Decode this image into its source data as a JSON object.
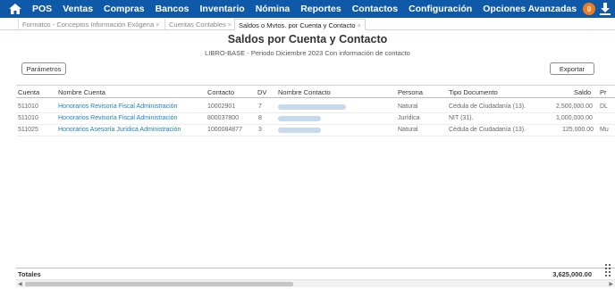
{
  "nav": {
    "items": [
      "POS",
      "Ventas",
      "Compras",
      "Bancos",
      "Inventario",
      "Nómina",
      "Reportes",
      "Contactos",
      "Configuración",
      "Opciones Avanzadas"
    ],
    "notification_count": "0"
  },
  "tabs": [
    {
      "label": "Formatos - Conceptos Información Exógena",
      "close": "×"
    },
    {
      "label": "Cuentas Contables",
      "close": "×"
    },
    {
      "label": "Saldos o Mvtos. por Cuenta y Contacto",
      "close": "×"
    }
  ],
  "report": {
    "title": "Saldos por Cuenta y Contacto",
    "subtitle": "LIBRO-BASE - Periodo Diciembre 2023 Con información de contacto"
  },
  "buttons": {
    "params": "Parámetros",
    "export": "Exportar"
  },
  "table": {
    "headers": [
      "Cuenta",
      "Nombre Cuenta",
      "Contacto",
      "DV",
      "Nombre Contacto",
      "Persona",
      "Tipo Documento",
      "Saldo",
      "Pr"
    ],
    "rows": [
      {
        "cuenta": "511010",
        "nombre_cuenta": "Honorarios Revisoría Fiscal Administración",
        "contacto": "10002901",
        "dv": "7",
        "persona": "Natural",
        "tipo_documento": "Cédula de Ciudadanía (13).",
        "saldo": "2,500,000.00",
        "pr": "DL"
      },
      {
        "cuenta": "511010",
        "nombre_cuenta": "Honorarios Revisoría Fiscal Administración",
        "contacto": "800037800",
        "dv": "8",
        "persona": "Jurídica",
        "tipo_documento": "NIT (31).",
        "saldo": "1,000,000.00",
        "pr": ""
      },
      {
        "cuenta": "511025",
        "nombre_cuenta": "Honorarios Asesoría Jurídica Administración",
        "contacto": "1000084877",
        "dv": "3",
        "persona": "Natural",
        "tipo_documento": "Cédula de Ciudadanía (13).",
        "saldo": "125,000.00",
        "pr": "Mu"
      }
    ]
  },
  "totals": {
    "label": "Totales",
    "value": "3,625,000.00"
  },
  "colors": {
    "nav_bg": "#0f5aa8",
    "link": "#1a7fc4",
    "badge": "#f07b1e"
  }
}
